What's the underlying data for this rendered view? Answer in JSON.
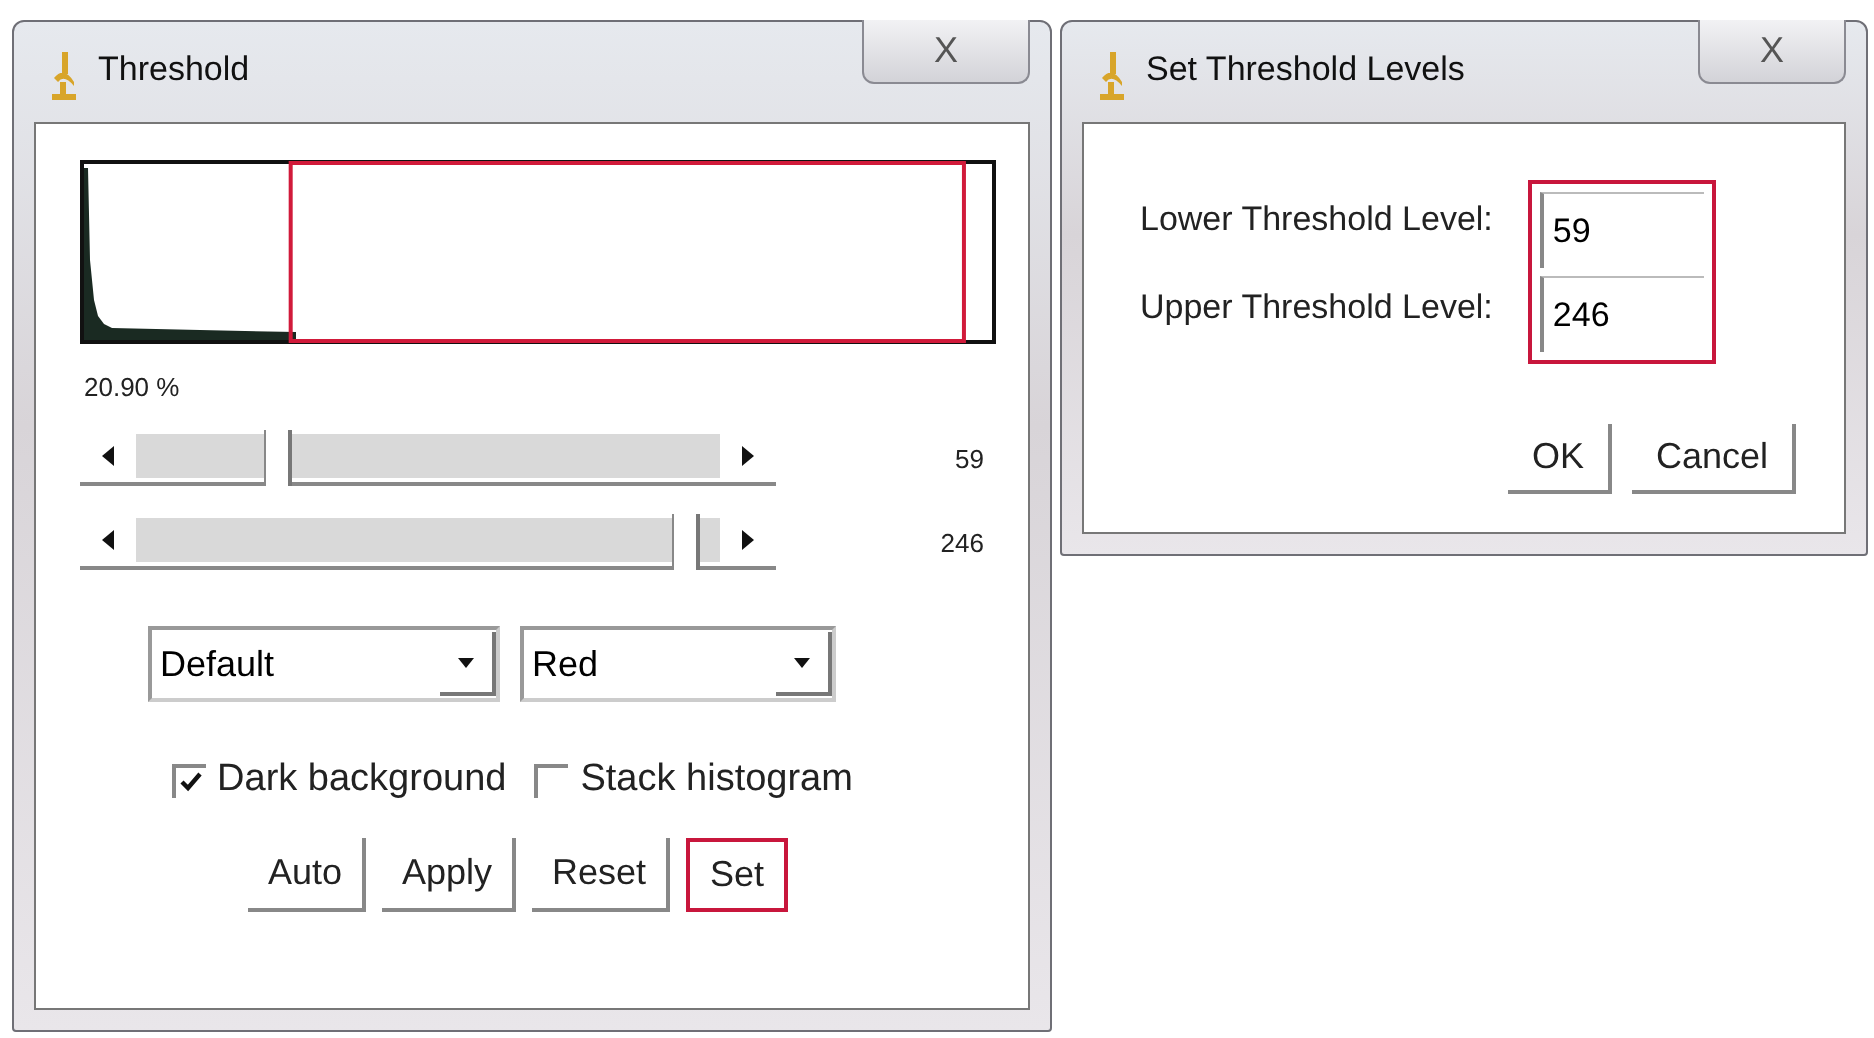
{
  "threshold_window": {
    "title": "Threshold",
    "close": "X",
    "percent": "20.90 %",
    "sliders": [
      {
        "level": 0.23,
        "reading": "59"
      },
      {
        "level": 0.965,
        "reading": "246"
      }
    ],
    "dropdowns": [
      {
        "value": "Default"
      },
      {
        "value": "Red"
      }
    ],
    "checkboxes": [
      {
        "label": "Dark background",
        "checked": true
      },
      {
        "label": "Stack histogram",
        "checked": false
      }
    ],
    "buttons": [
      {
        "label": "Auto",
        "highlighted": false
      },
      {
        "label": "Apply",
        "highlighted": false
      },
      {
        "label": "Reset",
        "highlighted": false
      },
      {
        "label": "Set",
        "highlighted": true
      }
    ]
  },
  "levels_dialog": {
    "title": "Set Threshold Levels",
    "close": "X",
    "fields_highlighted": true,
    "fields": [
      {
        "label": "Lower Threshold Level:",
        "value": "59"
      },
      {
        "label": "Upper Threshold Level:",
        "value": "246"
      }
    ],
    "buttons": [
      "OK",
      "Cancel"
    ]
  }
}
